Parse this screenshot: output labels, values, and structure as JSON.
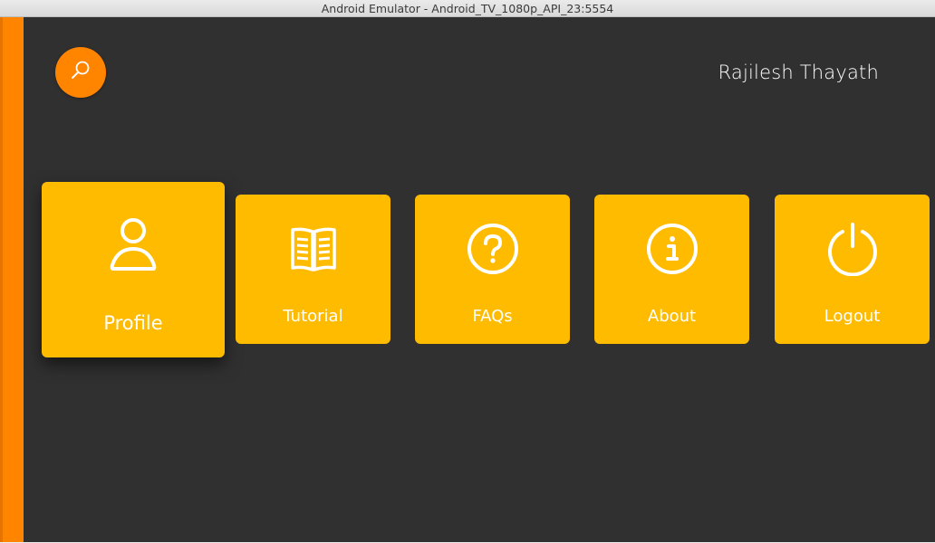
{
  "window": {
    "title": "Android Emulator - Android_TV_1080p_API_23:5554"
  },
  "header": {
    "search_icon": "search-icon",
    "user_name": "Rajilesh Thayath"
  },
  "menu": {
    "items": [
      {
        "label": "Profile",
        "icon": "person-icon"
      },
      {
        "label": "Tutorial",
        "icon": "book-icon"
      },
      {
        "label": "FAQs",
        "icon": "help-icon"
      },
      {
        "label": "About",
        "icon": "info-icon"
      },
      {
        "label": "Logout",
        "icon": "power-icon"
      }
    ]
  },
  "colors": {
    "background": "#303030",
    "accent": "#ff8400",
    "card": "#ffbb00",
    "text": "#ffffff"
  }
}
